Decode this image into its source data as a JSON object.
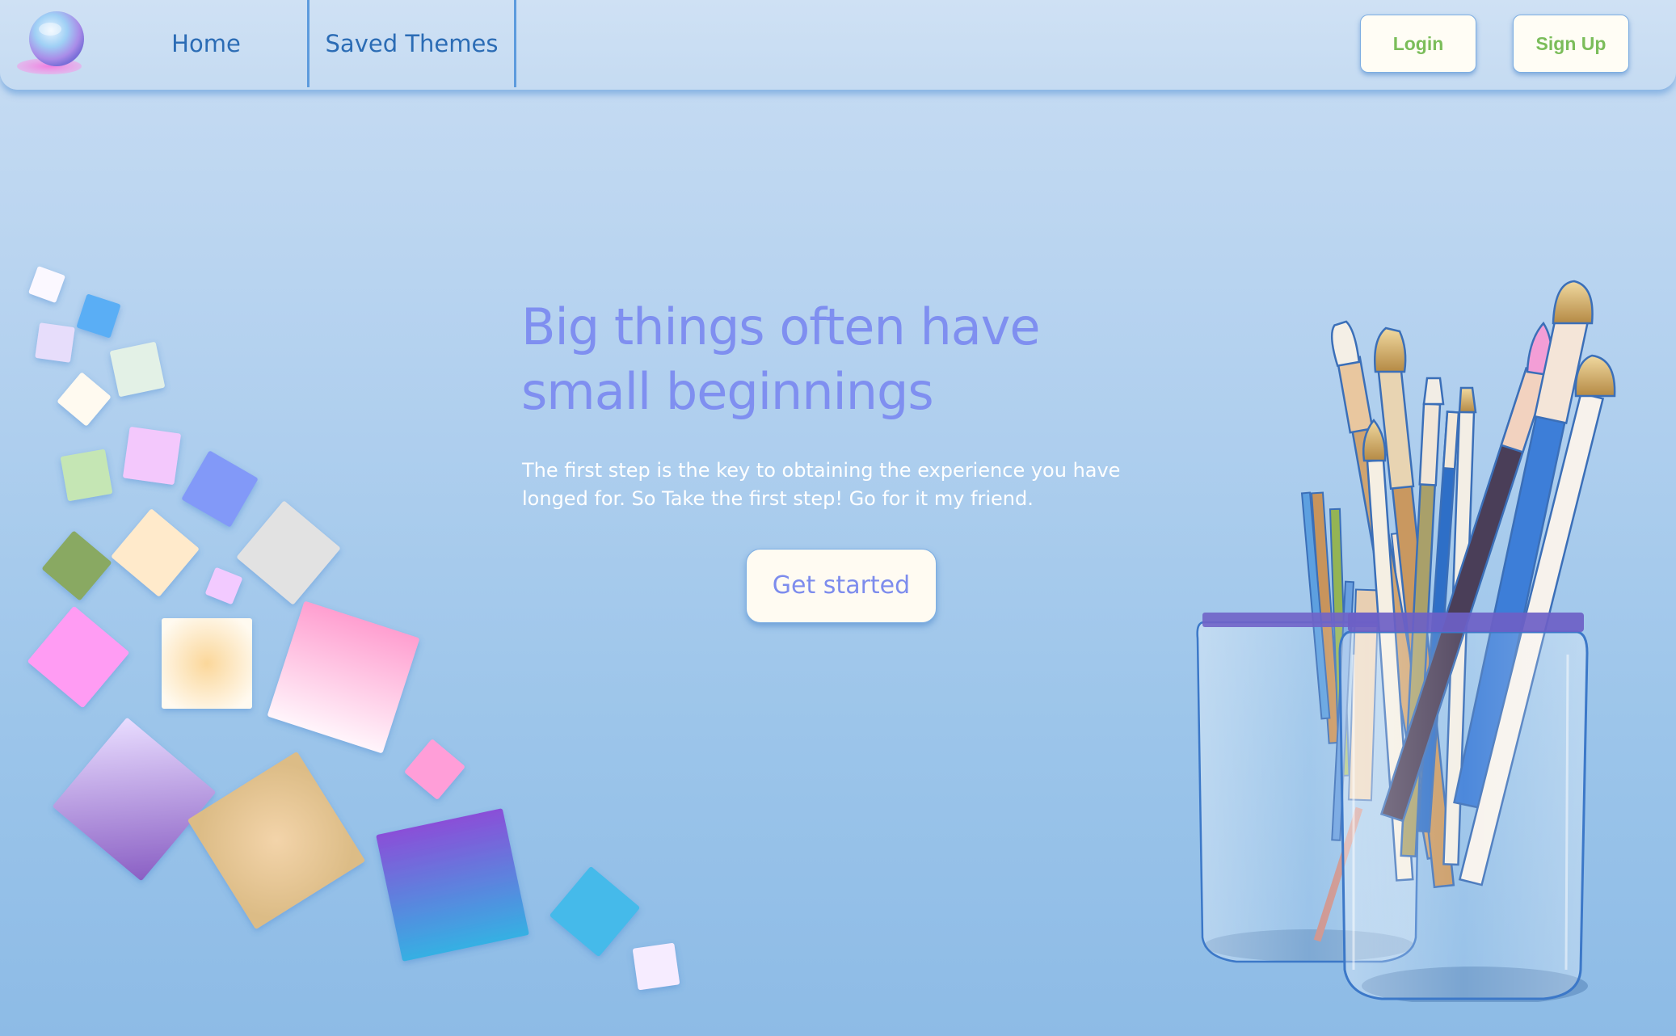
{
  "nav": {
    "home": "Home",
    "saved_themes": "Saved Themes",
    "login": "Login",
    "sign_up": "Sign Up"
  },
  "hero": {
    "title": "Big things often have small beginnings",
    "subtitle": "The first step is the key to obtaining the experience you have longed for. So Take the first step! Go for it my friend.",
    "cta": "Get started"
  },
  "colors": {
    "accent": "#7f8ff0",
    "nav_link": "#2b6cb5",
    "auth_text": "#7bbd5a",
    "background_top": "#c9ddf3",
    "background_bottom": "#8dbbe6"
  },
  "icons": {
    "logo": "globe-logo-icon",
    "left_art": "colorful-squares-illustration",
    "right_art": "paint-brushes-in-jars-illustration"
  }
}
